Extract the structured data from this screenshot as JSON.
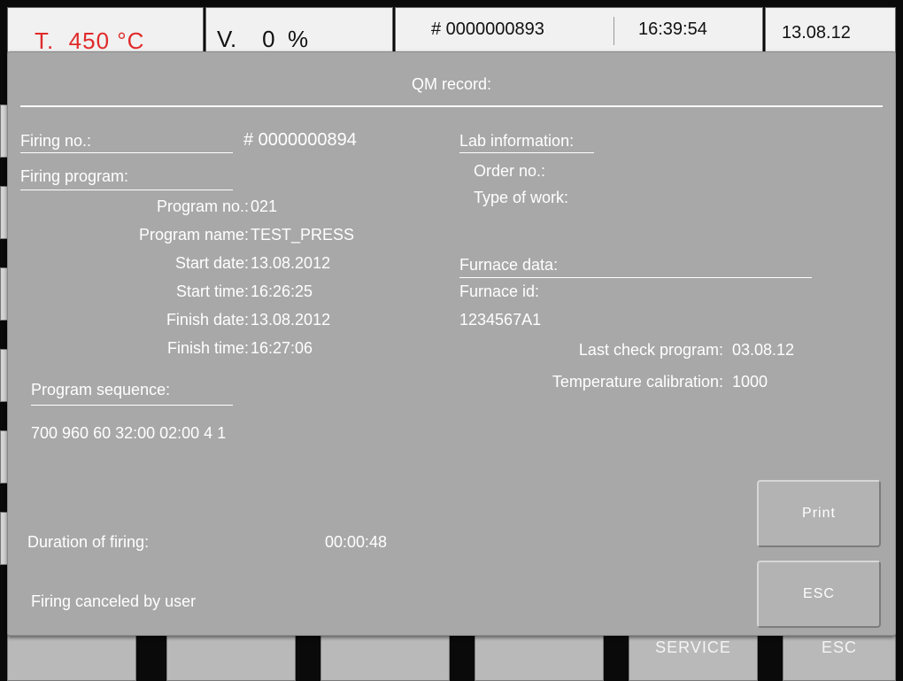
{
  "status_bar": {
    "temperature": "T.  450 °C",
    "vacuum": "V.    0  %",
    "firing_no": "# 0000000893",
    "time": "16:39:54",
    "date": "13.08.12"
  },
  "bottom_tabs": [
    "",
    "",
    "",
    "",
    "SERVICE",
    "ESC"
  ],
  "dialog": {
    "title": "QM record:",
    "firing_no_label": "Firing no.:",
    "firing_no_value": "#  0000000894",
    "firing_program_label": "Firing program:",
    "program_fields": [
      {
        "label": "Program no.:",
        "value": "021"
      },
      {
        "label": "Program name:",
        "value": "TEST_PRESS"
      },
      {
        "label": "Start date:",
        "value": "13.08.2012"
      },
      {
        "label": "Start time:",
        "value": "16:26:25"
      },
      {
        "label": "Finish date:",
        "value": "13.08.2012"
      },
      {
        "label": "Finish time:",
        "value": "16:27:06"
      }
    ],
    "program_sequence_label": "Program sequence:",
    "program_sequence_value": "700 960 60 32:00 02:00 4 1",
    "duration_label": "Duration of firing:",
    "duration_value": "00:00:48",
    "status_message": "Firing canceled by user",
    "lab_information_label": "Lab information:",
    "order_no_label": "Order no.:",
    "type_of_work_label": "Type of work:",
    "furnace_data_label": "Furnace data:",
    "furnace_id_label": "Furnace id:",
    "furnace_id_value": "1234567A1",
    "last_check_label": "Last check program:",
    "last_check_value": "03.08.12",
    "temp_calibration_label": "Temperature calibration:",
    "temp_calibration_value": "1000",
    "print_label": "Print",
    "esc_label": "ESC"
  }
}
